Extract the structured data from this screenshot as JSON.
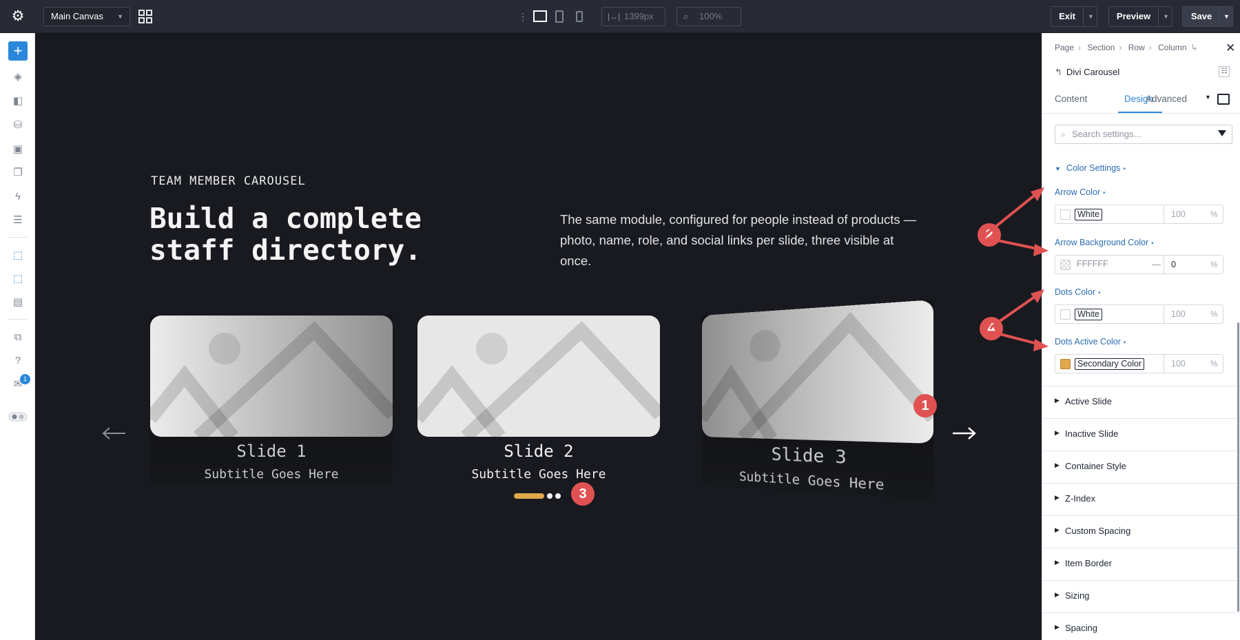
{
  "topbar": {
    "canvas_name": "Main Canvas",
    "width_value": "1399px",
    "zoom_value": "100%",
    "exit_label": "Exit",
    "preview_label": "Preview",
    "save_label": "Save"
  },
  "hero": {
    "eyebrow": "TEAM MEMBER CAROUSEL",
    "heading": "Build a complete staff directory.",
    "description": "The same module, configured for people instead of products — photo, name, role, and social links per slide, three visible at once."
  },
  "carousel": {
    "slides": [
      {
        "title": "Slide 1",
        "subtitle": "Subtitle Goes Here"
      },
      {
        "title": "Slide 2",
        "subtitle": "Subtitle Goes Here"
      },
      {
        "title": "Slide 3",
        "subtitle": "Subtitle Goes Here"
      }
    ],
    "active_dot_color": "#e0a84b"
  },
  "markers": [
    "1",
    "2",
    "3",
    "4"
  ],
  "panel": {
    "breadcrumbs": [
      "Page",
      "Section",
      "Row",
      "Column"
    ],
    "module_name": "Divi Carousel",
    "tabs": [
      "Content",
      "Design",
      "Advanced"
    ],
    "active_tab": "Design",
    "search_placeholder": "Search settings...",
    "group_title": "Color Settings",
    "fields": [
      {
        "label": "Arrow Color",
        "value": "White",
        "opacity": "100",
        "unit": "%"
      },
      {
        "label": "Arrow Background Color",
        "value": "FFFFFF",
        "opacity": "0",
        "unit": "%"
      },
      {
        "label": "Dots Color",
        "value": "White",
        "opacity": "100",
        "unit": "%"
      },
      {
        "label": "Dots Active Color",
        "value": "Secondary Color",
        "opacity": "100",
        "unit": "%"
      }
    ],
    "sections": [
      "Active Slide",
      "Inactive Slide",
      "Container Style",
      "Z-Index",
      "Custom Spacing",
      "Item Border",
      "Sizing",
      "Spacing"
    ]
  },
  "colors": {
    "accent": "#2b87da",
    "marker": "#e05251",
    "secondary": "#e0a84b"
  },
  "sidebar": {
    "notification_count": "1"
  }
}
